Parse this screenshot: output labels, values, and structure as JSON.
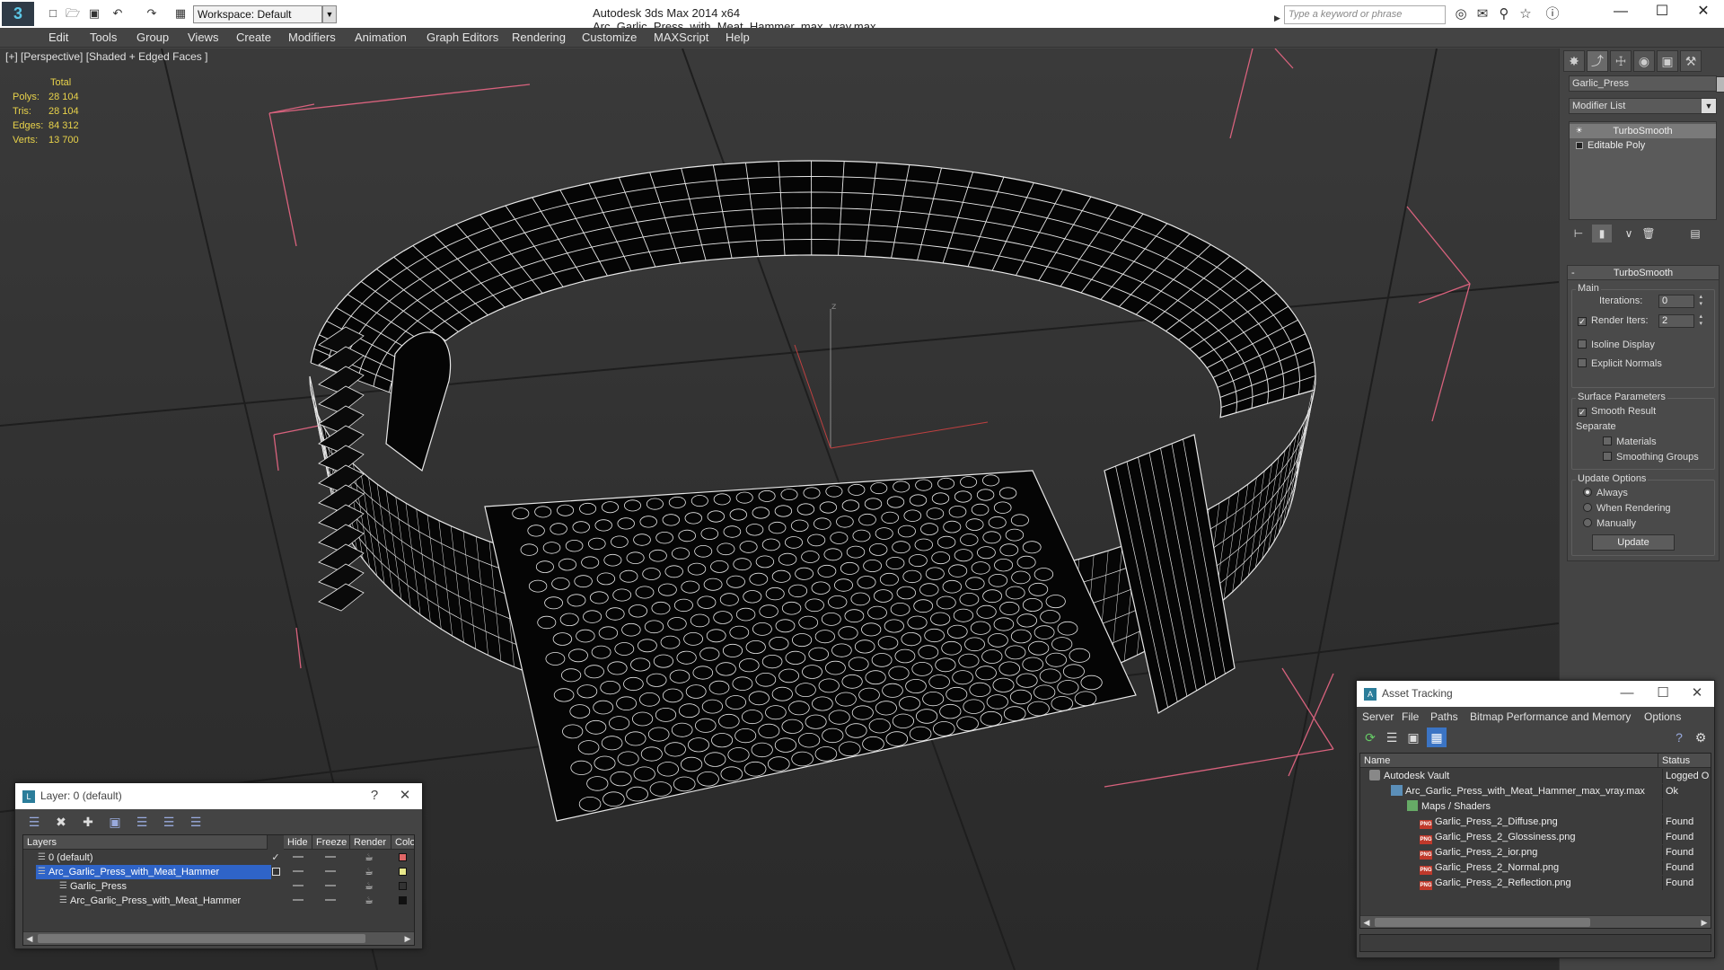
{
  "titlebar": {
    "app": "Autodesk 3ds Max  2014 x64",
    "file": "Arc_Garlic_Press_with_Meat_Hammer_max_vray.max",
    "workspace": "Workspace: Default",
    "search_placeholder": "Type a keyword or phrase"
  },
  "menu": [
    "Edit",
    "Tools",
    "Group",
    "Views",
    "Create",
    "Modifiers",
    "Animation",
    "Graph Editors",
    "Rendering",
    "Customize",
    "MAXScript",
    "Help"
  ],
  "viewport": {
    "label": "[+] [Perspective] [Shaded + Edged Faces ]",
    "stats": {
      "total_label": "Total",
      "rows": [
        {
          "label": "Polys:",
          "value": "28 104"
        },
        {
          "label": "Tris:",
          "value": "28 104"
        },
        {
          "label": "Edges:",
          "value": "84 312"
        },
        {
          "label": "Verts:",
          "value": "13 700"
        }
      ]
    },
    "axis_label": "z"
  },
  "command_panel": {
    "object_name": "Garlic_Press",
    "modifier_list": "Modifier List",
    "stack": [
      "TurboSmooth",
      "Editable Poly"
    ],
    "turbosmooth": {
      "title": "TurboSmooth",
      "main_label": "Main",
      "iterations_label": "Iterations:",
      "iterations_value": "0",
      "render_iters_label": "Render Iters:",
      "render_iters_value": "2",
      "isoline_label": "Isoline Display",
      "explicit_normals_label": "Explicit Normals",
      "surface_label": "Surface Parameters",
      "smooth_result_label": "Smooth Result",
      "separate_label": "Separate",
      "materials_label": "Materials",
      "smoothing_groups_label": "Smoothing Groups",
      "update_options_label": "Update Options",
      "always_label": "Always",
      "when_rendering_label": "When Rendering",
      "manually_label": "Manually",
      "update_button": "Update"
    }
  },
  "layer_window": {
    "title": "Layer: 0 (default)",
    "help": "?",
    "columns": [
      "Layers",
      "Hide",
      "Freeze",
      "Render",
      "Colo"
    ],
    "rows": [
      {
        "name": "0 (default)",
        "color": "#e06666",
        "check": true
      },
      {
        "name": "Arc_Garlic_Press_with_Meat_Hammer",
        "color": "#e8e88a",
        "selected": true
      },
      {
        "name": "Garlic_Press",
        "color": "#333333"
      },
      {
        "name": "Arc_Garlic_Press_with_Meat_Hammer",
        "color": "#111111"
      }
    ]
  },
  "asset_tracking": {
    "title": "Asset Tracking",
    "menu": [
      "Server",
      "File",
      "Paths",
      "Bitmap Performance and Memory",
      "Options"
    ],
    "columns": [
      "Name",
      "Status"
    ],
    "rows": [
      {
        "name": "Autodesk Vault",
        "status": "Logged O"
      },
      {
        "name": "Arc_Garlic_Press_with_Meat_Hammer_max_vray.max",
        "status": "Ok"
      },
      {
        "name": "Maps / Shaders",
        "status": ""
      },
      {
        "name": "Garlic_Press_2_Diffuse.png",
        "status": "Found"
      },
      {
        "name": "Garlic_Press_2_Glossiness.png",
        "status": "Found"
      },
      {
        "name": "Garlic_Press_2_ior.png",
        "status": "Found"
      },
      {
        "name": "Garlic_Press_2_Normal.png",
        "status": "Found"
      },
      {
        "name": "Garlic_Press_2_Reflection.png",
        "status": "Found"
      }
    ],
    "png_badge": "PNG"
  }
}
